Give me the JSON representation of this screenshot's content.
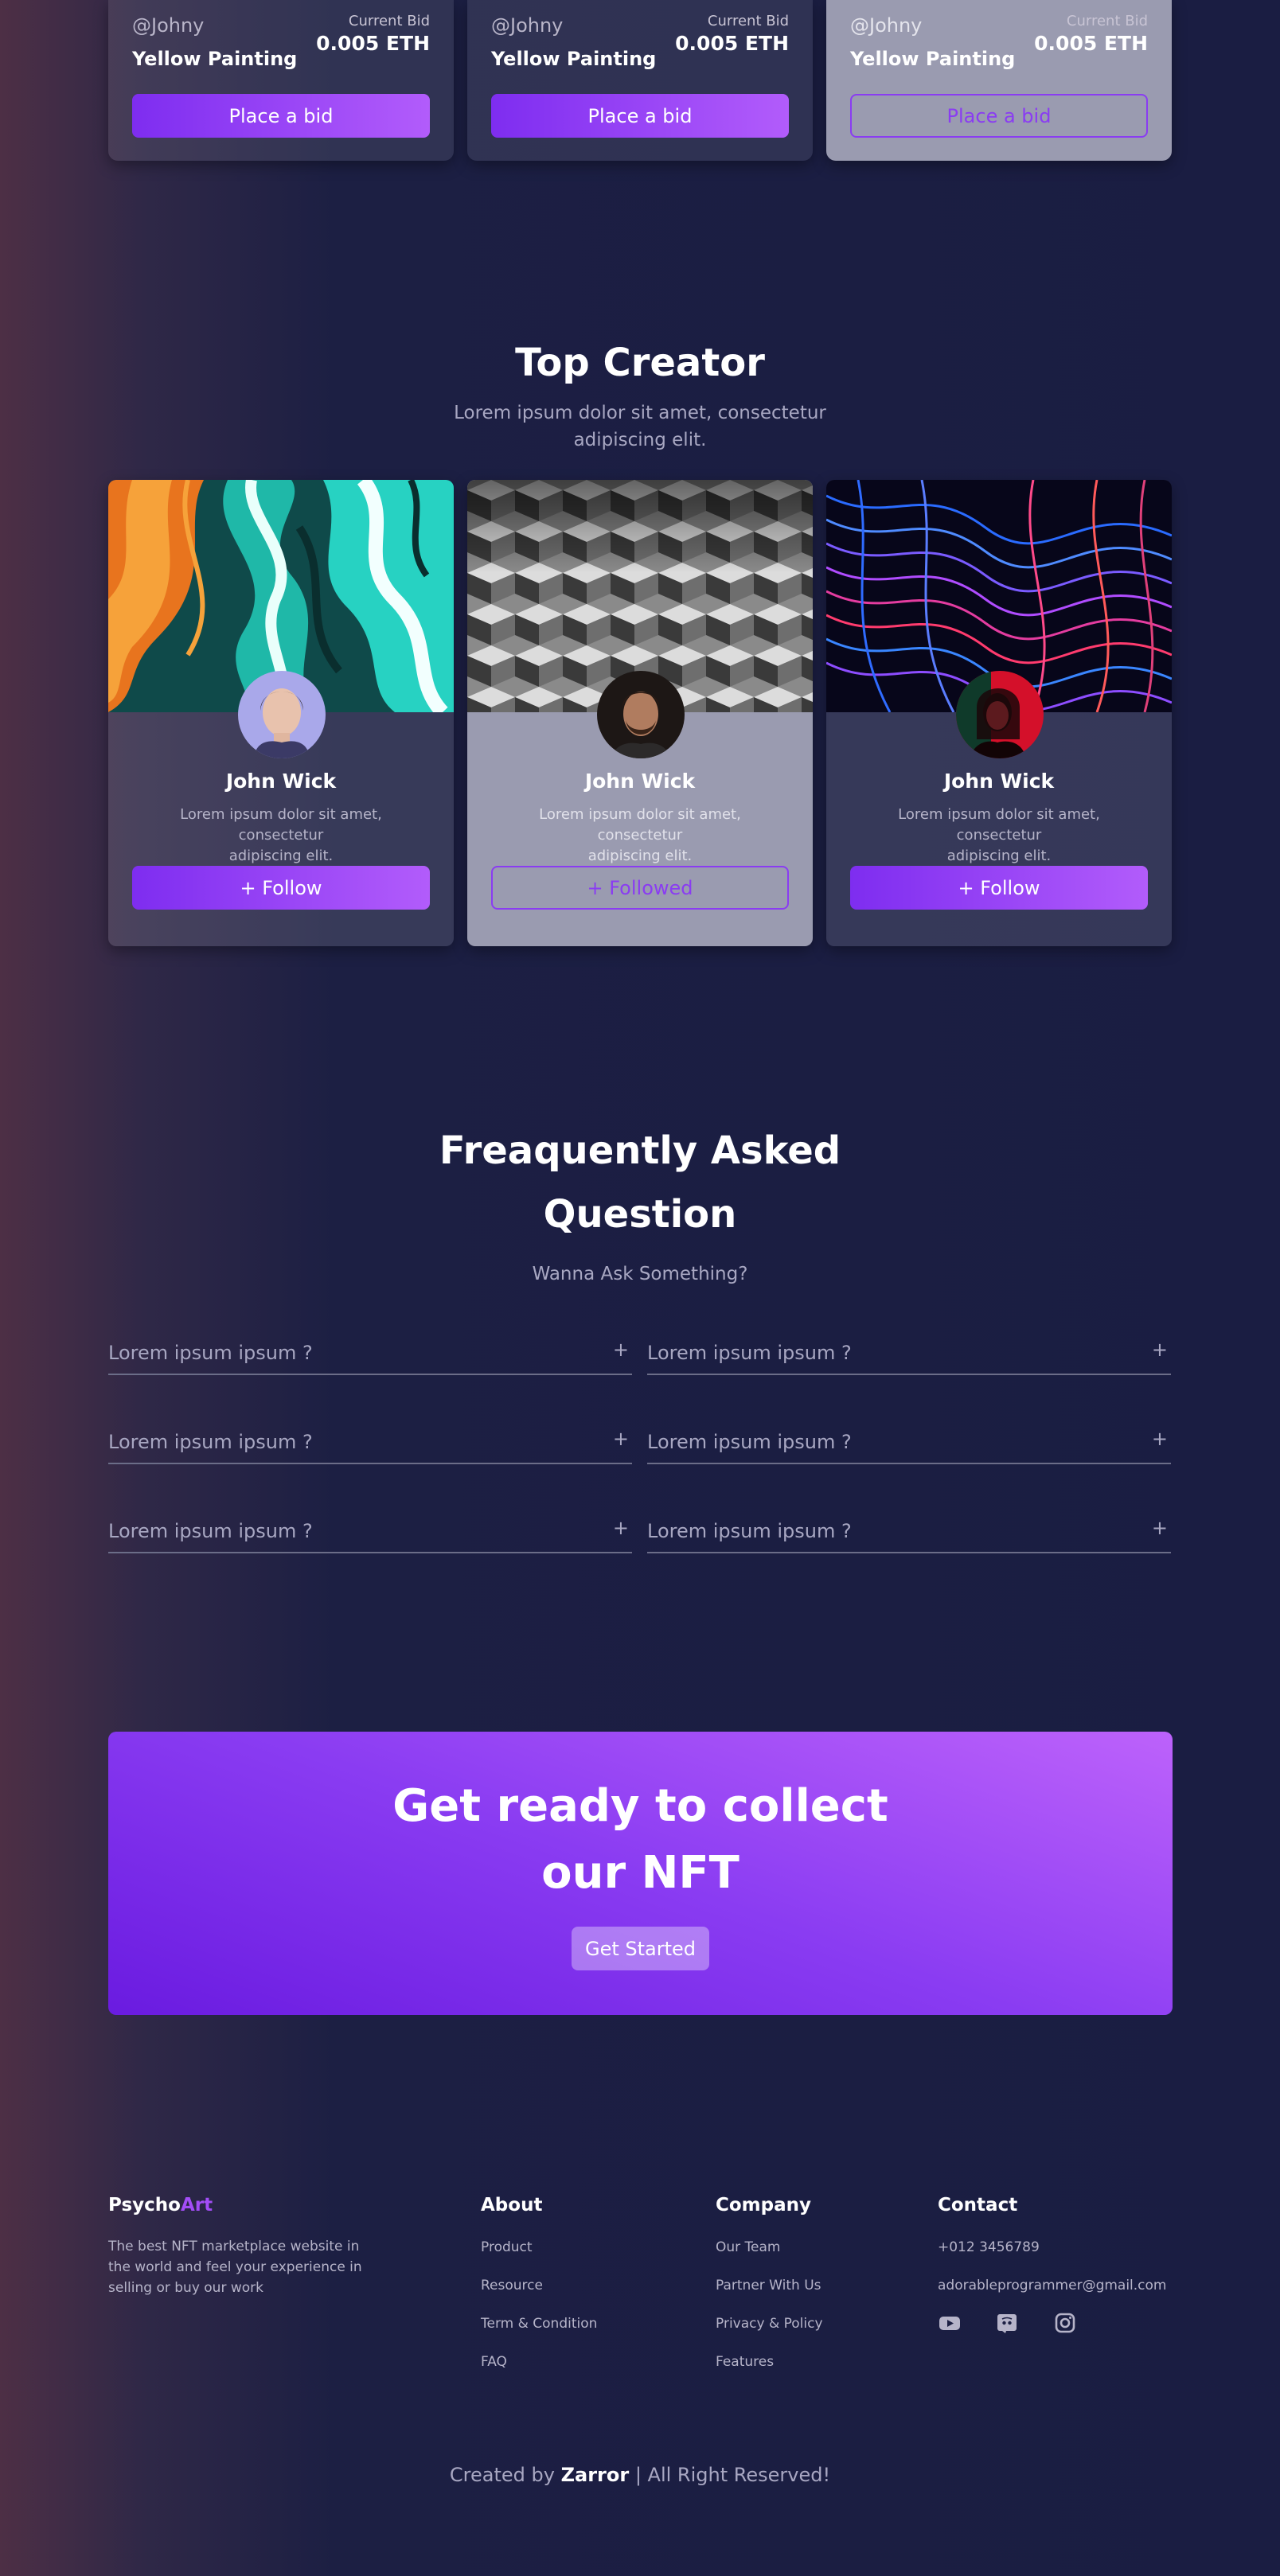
{
  "bids": [
    {
      "user": "@Johny",
      "title": "Yellow Painting",
      "current_label": "Current Bid",
      "current_value": "0.005 ETH",
      "button": "Place a bid"
    },
    {
      "user": "@Johny",
      "title": "Yellow Painting",
      "current_label": "Current Bid",
      "current_value": "0.005 ETH",
      "button": "Place a bid"
    },
    {
      "user": "@Johny",
      "title": "Yellow Painting",
      "current_label": "Current Bid",
      "current_value": "0.005 ETH",
      "button": "Place a bid"
    }
  ],
  "top_creator": {
    "title": "Top Creator",
    "subtitle_line1": "Lorem ipsum dolor sit amet, consectetur",
    "subtitle_line2": "adipiscing elit.",
    "creators": [
      {
        "name": "John Wick",
        "desc_line1": "Lorem ipsum dolor sit amet, consectetur",
        "desc_line2": "adipiscing elit.",
        "button": "+ Follow"
      },
      {
        "name": "John Wick",
        "desc_line1": "Lorem ipsum dolor sit amet, consectetur",
        "desc_line2": "adipiscing elit.",
        "button": "+ Followed"
      },
      {
        "name": "John Wick",
        "desc_line1": "Lorem ipsum dolor sit amet, consectetur",
        "desc_line2": "adipiscing elit.",
        "button": "+ Follow"
      }
    ]
  },
  "faq": {
    "title_line1": "Freaquently Asked",
    "title_line2": "Question",
    "subtitle": "Wanna Ask Something?",
    "plus": "+",
    "items": [
      "Lorem ipsum ipsum ?",
      "Lorem ipsum ipsum ?",
      "Lorem ipsum ipsum ?",
      "Lorem ipsum ipsum ?",
      "Lorem ipsum ipsum ?",
      "Lorem ipsum ipsum ?"
    ]
  },
  "cta": {
    "title_line1": "Get ready to collect",
    "title_line2": "our NFT",
    "button": "Get Started"
  },
  "footer": {
    "brand_part1": "Psycho",
    "brand_part2": "Art",
    "desc_line1": "The best NFT marketplace website in",
    "desc_line2": "the world and feel your experience in",
    "desc_line3": "selling or buy our work",
    "about": {
      "title": "About",
      "links": [
        "Product",
        "Resource",
        "Term & Condition",
        "FAQ"
      ]
    },
    "company": {
      "title": "Company",
      "links": [
        "Our Team",
        "Partner With Us",
        "Privacy & Policy",
        "Features"
      ]
    },
    "contact": {
      "title": "Contact",
      "phone": "+012 3456789",
      "email": "adorableprogrammer@gmail.com"
    },
    "social_icons": [
      "youtube-icon",
      "discord-icon",
      "instagram-icon"
    ],
    "copyright_prefix": "Created by",
    "copyright_name": "Zarror",
    "copyright_suffix": "| All Right Reserved!"
  },
  "colors": {
    "background": "#1c1f43",
    "accent": "#8a3cf2",
    "brand_accent": "#a34df7"
  }
}
